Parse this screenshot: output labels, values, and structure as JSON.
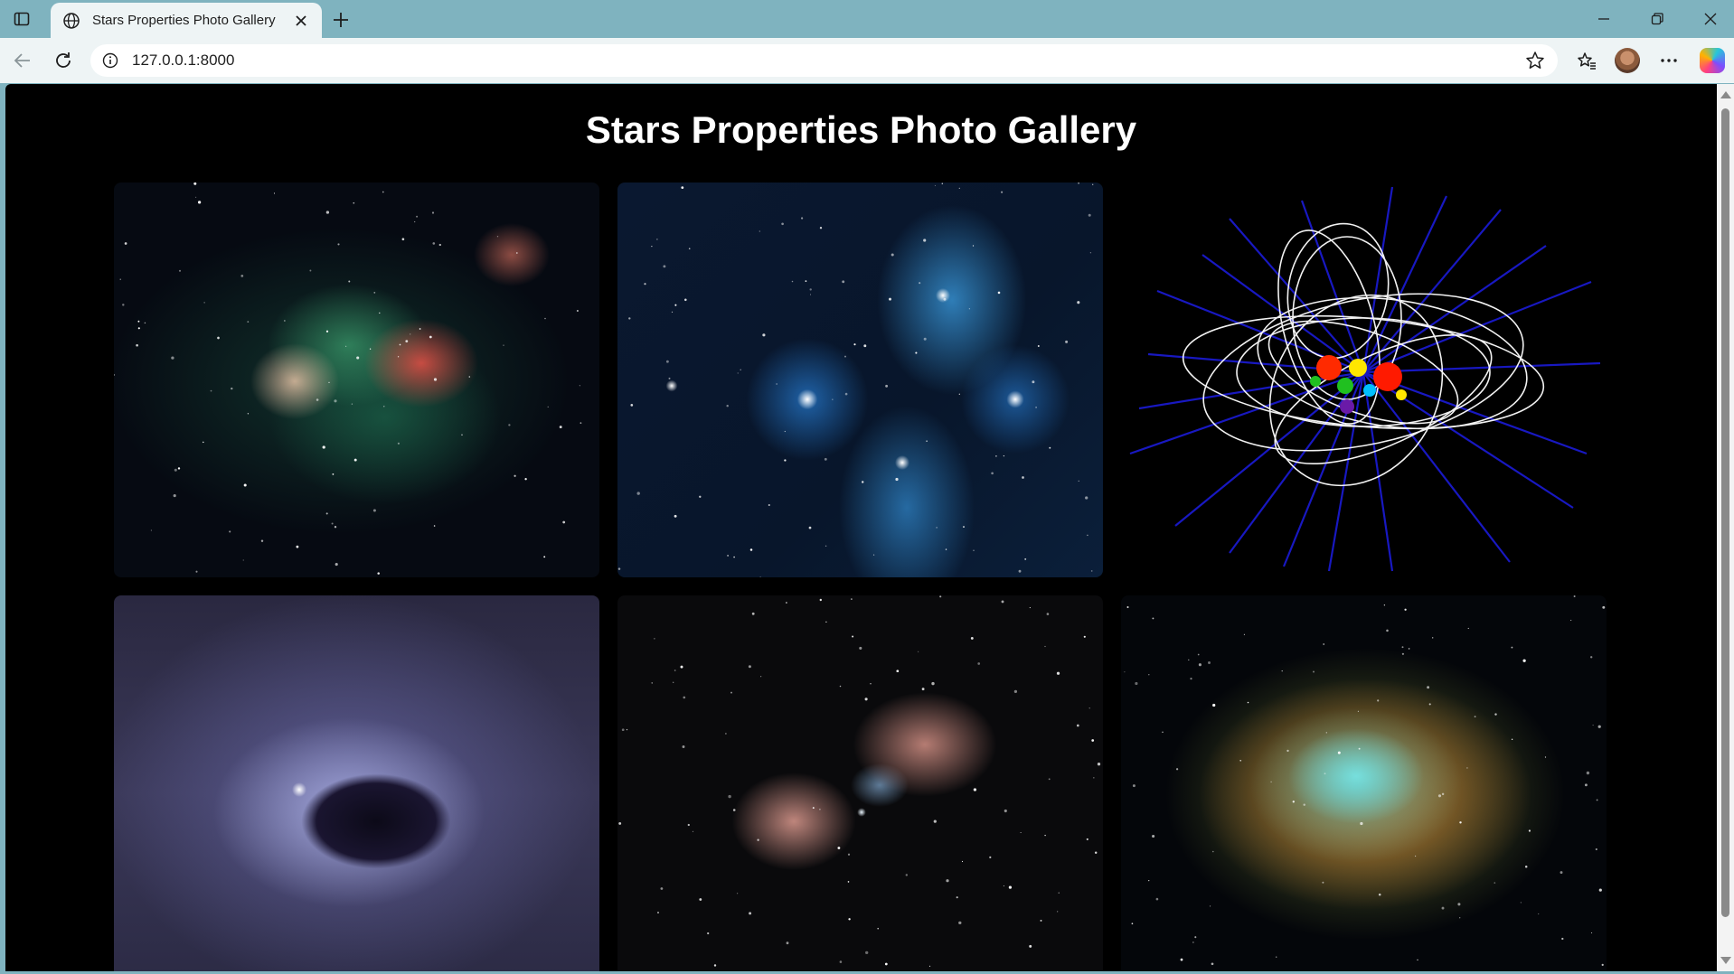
{
  "browser": {
    "tab_title": "Stars Properties Photo Gallery",
    "url": "127.0.0.1:8000",
    "icons": {
      "sidebar": "tab-actions-icon",
      "tab": "globe-icon",
      "close": "close-icon",
      "new_tab": "plus-icon",
      "back": "back-arrow-icon",
      "reload": "reload-icon",
      "info": "info-icon",
      "favorite": "star-icon",
      "favorites": "favorites-icon",
      "more": "more-icon"
    }
  },
  "page": {
    "title": "Stars Properties Photo Gallery",
    "background": "#000000",
    "gallery": [
      {
        "id": "photo-1",
        "subject": "star-forming nebula (green and red)"
      },
      {
        "id": "photo-2",
        "subject": "star cluster in blue nebula"
      },
      {
        "id": "photo-3",
        "subject": "stellar magnetic field lines"
      },
      {
        "id": "photo-4",
        "subject": "reflection nebula with dark cavity"
      },
      {
        "id": "photo-5",
        "subject": "bipolar nebula around massive star"
      },
      {
        "id": "photo-6",
        "subject": "supernova remnant filaments"
      }
    ]
  }
}
